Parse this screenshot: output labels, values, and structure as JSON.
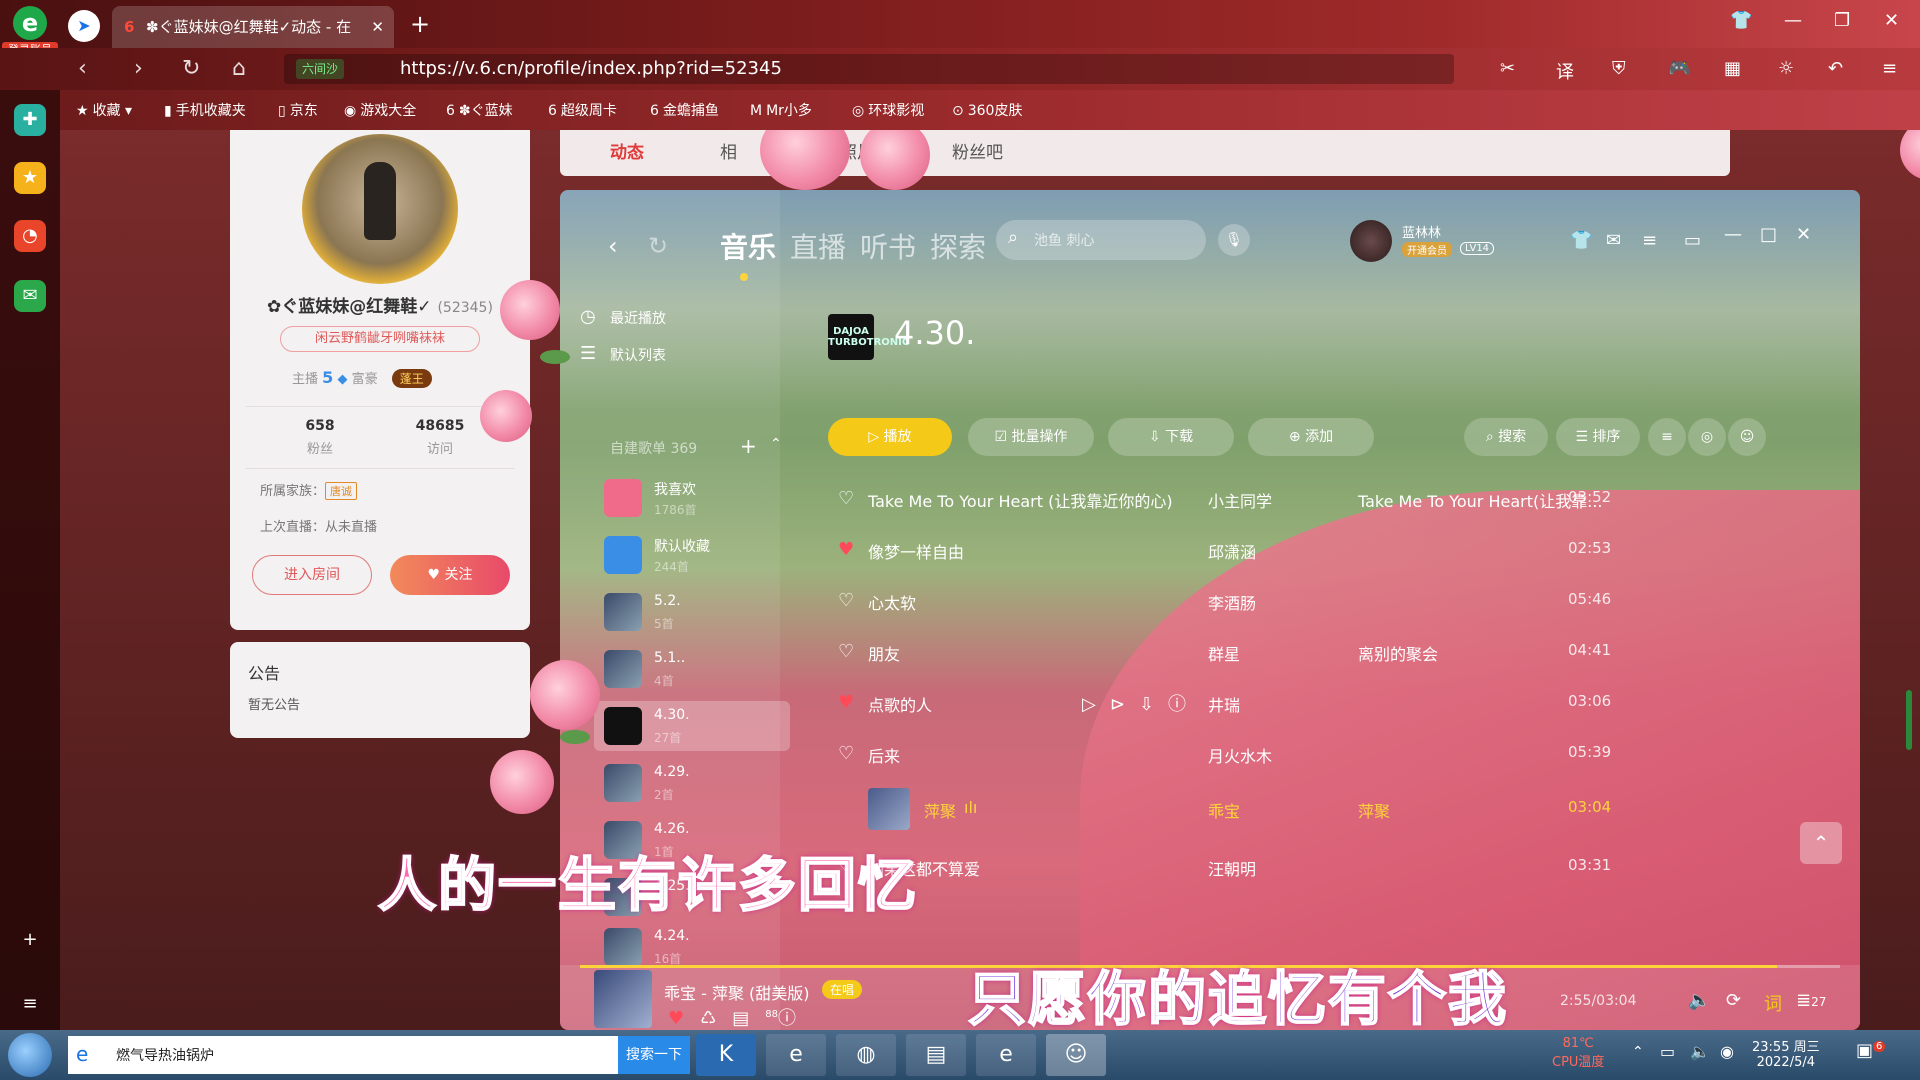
{
  "browser": {
    "login_label": "登录账号",
    "tab_title": "✽ぐ蓝妹妹@红舞鞋✓动态 - 在",
    "url_shield": "六间沙",
    "url": "https://v.6.cn/profile/index.php?rid=52345",
    "bookmarks": [
      "收藏",
      "手机收藏夹",
      "京东",
      "游戏大全",
      "✽ぐ蓝妹",
      "超级周卡",
      "金蟾捕鱼",
      "Mr小多",
      "环球影视",
      "360皮肤"
    ]
  },
  "profile": {
    "name": "✿ぐ蓝妹妹@红舞鞋✓",
    "rid": "(52345)",
    "signature": "闲云野鹤龇牙咧嘴袜袜",
    "rank_label": "主播",
    "rank_level": "5",
    "rich_label": "富豪",
    "rich_badge": "蓬王",
    "fans_count": "658",
    "fans_label": "粉丝",
    "visits_count": "48685",
    "visits_label": "访问",
    "family_label": "所属家族：",
    "family_tag": "唐诚",
    "last_live": "上次直播：从未直播",
    "enter_room": "进入房间",
    "follow": "关注"
  },
  "notice": {
    "title": "公告",
    "body": "暂无公告"
  },
  "page_tabs": [
    "动态",
    "相",
    "照片",
    "粉丝吧"
  ],
  "player": {
    "nav": [
      "音乐",
      "直播",
      "听书",
      "探索"
    ],
    "search_placeholder": "池鱼 刺心",
    "username": "蓝林林",
    "vip_label": "开通会员",
    "level": "LV14",
    "sidebar": {
      "recent": "最近播放",
      "default_list": "默认列表",
      "created_header": "自建歌单 369",
      "playlists": [
        {
          "name": "我喜欢",
          "count": "1786首"
        },
        {
          "name": "默认收藏",
          "count": "244首"
        },
        {
          "name": "5.2.",
          "count": "5首"
        },
        {
          "name": "5.1..",
          "count": "4首"
        },
        {
          "name": "4.30.",
          "count": "27首"
        },
        {
          "name": "4.29.",
          "count": "2首"
        },
        {
          "name": "4.26.",
          "count": "1首"
        },
        {
          "name": "4.25.",
          "count": ""
        },
        {
          "name": "4.24.",
          "count": "16首"
        }
      ]
    },
    "album": {
      "cover_text": "DAJOA TURBOTRONIC",
      "title": "4.30."
    },
    "actions": {
      "play": "播放",
      "batch": "批量操作",
      "download": "下载",
      "add": "添加",
      "search": "搜索",
      "sort": "排序"
    },
    "songs": [
      {
        "title": "Take Me To Your Heart (让我靠近你的心)",
        "artist": "小主同学",
        "album": "Take Me To Your Heart(让我靠...",
        "duration": "03:52"
      },
      {
        "title": "像梦一样自由",
        "artist": "邱潇涵",
        "album": "",
        "duration": "02:53"
      },
      {
        "title": "心太软",
        "artist": "李酒肠",
        "album": "",
        "duration": "05:46"
      },
      {
        "title": "朋友",
        "artist": "群星",
        "album": "离别的聚会",
        "duration": "04:41"
      },
      {
        "title": "点歌的人",
        "artist": "井瑞",
        "album": "",
        "duration": "03:06"
      },
      {
        "title": "后来",
        "artist": "月火水木",
        "album": "",
        "duration": "05:39"
      },
      {
        "title": "萍聚",
        "artist": "乖宝",
        "album": "萍聚",
        "duration": "03:04"
      },
      {
        "title": "如果这都不算爱",
        "artist": "汪朝明",
        "album": "",
        "duration": "03:31"
      }
    ],
    "now_playing": {
      "title": "乖宝 - 萍聚 (甜美版)",
      "singing": "在唱",
      "comments": "88",
      "time": "2:55/03:04",
      "queue": "27",
      "lyric_btn": "词",
      "progress": 0.95
    },
    "lyrics": [
      "人的一生有许多回忆",
      "只愿你的追忆有个我"
    ]
  },
  "taskbar": {
    "search_query": "燃气导热油锅炉",
    "search_button": "搜索一下",
    "temp": "81℃",
    "temp_label": "CPU温度",
    "time": "23:55 周三",
    "date": "2022/5/4",
    "notif_count": "6"
  }
}
